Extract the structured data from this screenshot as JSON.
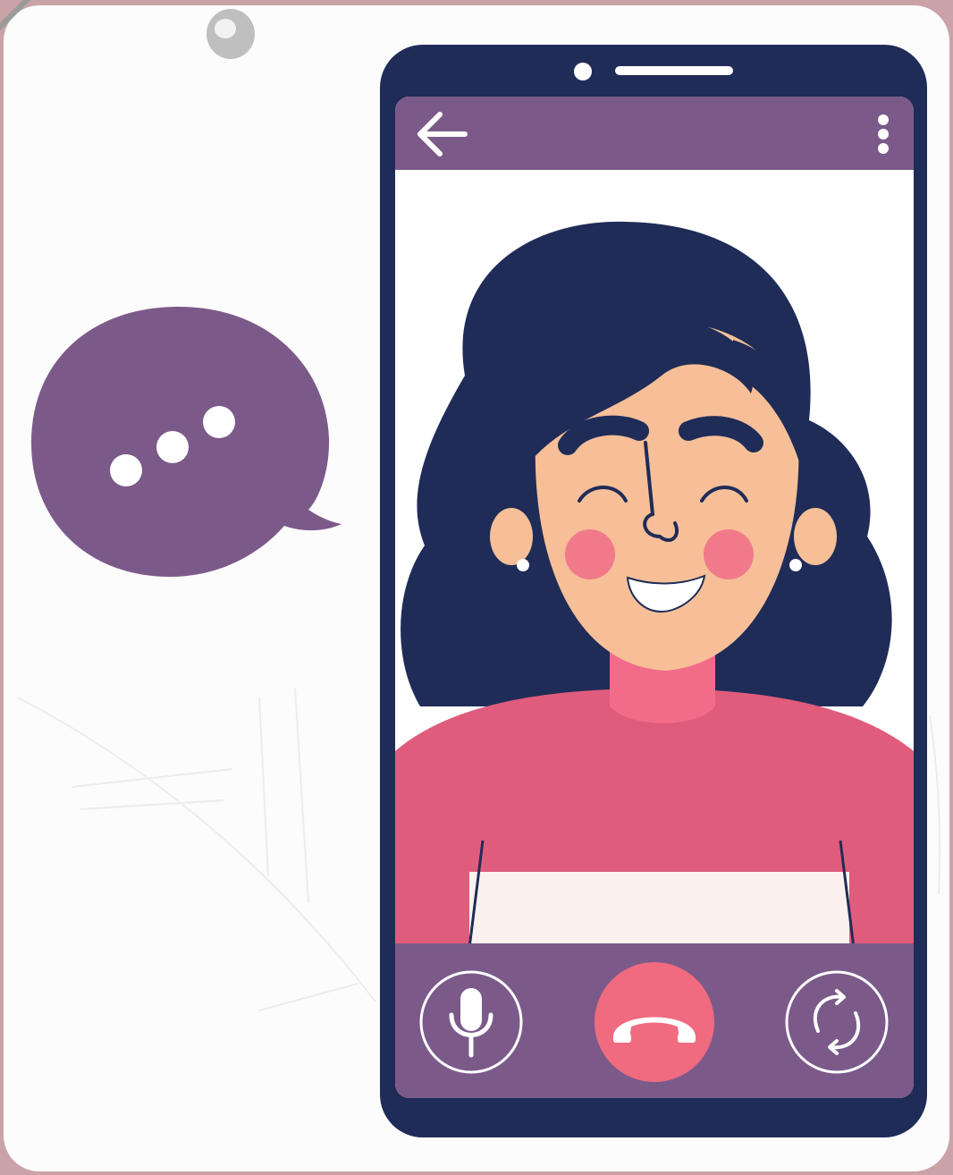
{
  "colors": {
    "frame_bg": "#c9a3a6",
    "card_bg": "#fdfcfc",
    "phone_body": "#1f2c57",
    "accent_purple": "#7b5a8a",
    "hair": "#1f2c57",
    "skin": "#f6bf98",
    "cheek": "#f07a8a",
    "sweater": "#e05c7c",
    "shirt_stripe": "#fdf1ef",
    "end_call": "#f06b80",
    "screen_bg": "#ffffff"
  },
  "phone": {
    "header": {
      "back_icon": "arrow-left-icon",
      "menu_icon": "more-vertical-icon"
    },
    "controls": {
      "mic_icon": "microphone-icon",
      "end_call_icon": "phone-hangup-icon",
      "switch_icon": "camera-switch-icon"
    }
  },
  "speech_bubble": {
    "icon": "typing-dots-icon"
  }
}
